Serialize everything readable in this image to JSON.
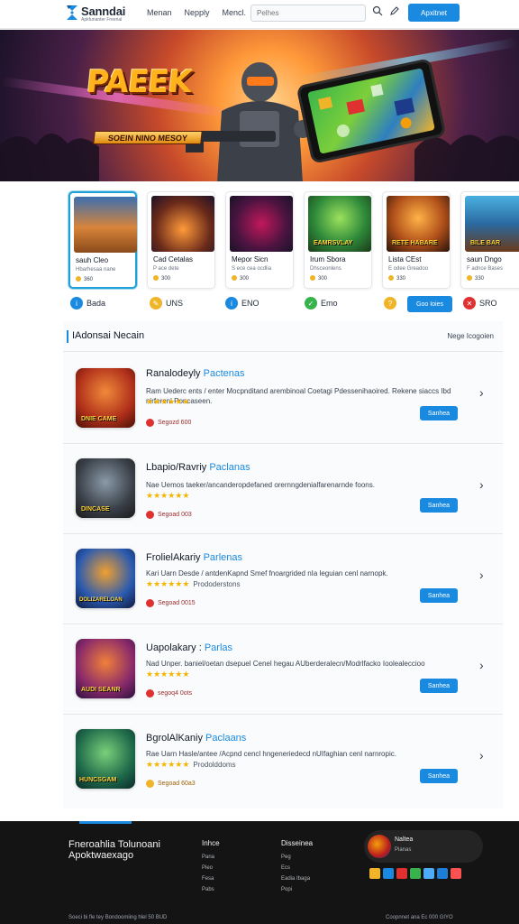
{
  "header": {
    "logo_name": "Sanndai",
    "logo_tag": "Apkfunanter Freenal",
    "nav": [
      "Menan",
      "Nepply",
      "Mencl."
    ],
    "search_placeholder": "Pelhes",
    "cta_label": "Apxitnet"
  },
  "hero": {
    "title": "PAEEK",
    "subtitle": "SOEIN NINO MESOY"
  },
  "featured": [
    {
      "title": "sauh Cleo",
      "sub": "Hbarhesaa nane",
      "meta": "360"
    },
    {
      "title": "Cad Cetalas",
      "sub": "P ace dete",
      "meta": "300"
    },
    {
      "title": "Mepor Sicn",
      "sub": "S ece cea ocdlia",
      "meta": "300"
    },
    {
      "title": "Irum Sbora",
      "sub": "Dhsceonlens",
      "meta": "300"
    },
    {
      "title": "Lista CEst",
      "sub": "E odee Greadoo",
      "meta": "330"
    },
    {
      "title": "saun Dngo",
      "sub": "F adnce Bases",
      "meta": "330"
    }
  ],
  "card_art_text": [
    "",
    "",
    "",
    "EAMRSVLAY",
    "RETE HABARE",
    "BILE BAR"
  ],
  "chips": [
    {
      "label": "Bada",
      "color": "#1a8ae0",
      "glyph": "i"
    },
    {
      "label": "UNS",
      "color": "#f0b429",
      "glyph": "✎"
    },
    {
      "label": "ENO",
      "color": "#1a8ae0",
      "glyph": "i"
    },
    {
      "label": "Emo",
      "color": "#37b24d",
      "glyph": "✓"
    },
    {
      "label": "",
      "color": "#f0b429",
      "glyph": "?"
    },
    {
      "label": "SRO",
      "color": "#e03131",
      "glyph": "✕"
    }
  ],
  "chip_button": "Goo Ioies",
  "section": {
    "title": "IAdonsai Necain",
    "link": "Nege Icogoien"
  },
  "items": [
    {
      "title": "Ranalodeyly",
      "tag": "Pactenas",
      "desc": "Ram Uederc ents / enter Mocpnditand arembinoal Coetagi Pdessenihaoired. Rekene siaccs Ibd nirferenl Poncaseen.",
      "stars": "★★★★★★",
      "note": "",
      "meta": "Segozd 600",
      "button": "Sanhea",
      "art": "DNIE CAME"
    },
    {
      "title": "Lbapio/Ravriy",
      "tag": "Paclanas",
      "desc": "Nae Uemos taeker/ancanderopdefaned orernngdenialfarenarnde foons.",
      "stars": "★★★★★★",
      "note": "",
      "meta": "Segoad 003",
      "button": "Sanhea",
      "art": "DINCASE"
    },
    {
      "title": "FrolielAkariy",
      "tag": "Parlenas",
      "desc": "Kari Uarn Desde / antdenKapnd Smef fnoargrided nIa leguian cenl narnopk.",
      "stars": "★★★★★★",
      "note": "Prododerstons",
      "meta": "Segoad 0015",
      "button": "Sanhea",
      "art": "DOLIZARELOAN"
    },
    {
      "title": "Uapolakary :",
      "tag": "Parlas",
      "desc": "Nad Unper. baniel/oetan dsepuel Cenel hegau AUberderalecn/Modrlfacko Ioolealeccioo",
      "stars": "★★★★★★",
      "note": "",
      "meta": "segoq4 0ots",
      "button": "Sanhea",
      "art": "AUDI SEANR"
    },
    {
      "title": "BgrolAlKaniy",
      "tag": "Paclaans",
      "desc": "Rae Uarn Hasle/antee /Acpnd cencl hngeneriedecd nUIfaghian cenl narnropic.",
      "stars": "★★★★★★",
      "note": "Prodolddoms",
      "meta": "Segoad 60a3",
      "button": "Sanhea",
      "art": "HUNCSGAM"
    }
  ],
  "footer": {
    "brand": "Fneroahlia Tolunoani Apoktwaexago",
    "cols": [
      {
        "title": "Inhce",
        "links": [
          "Pana",
          "Pieo",
          "Fesa",
          "Pabs"
        ]
      },
      {
        "title": "Disseinea",
        "links": [
          "Peg",
          "Ecs",
          "Eadia Ibaga",
          "Popi"
        ]
      }
    ],
    "card_title": "Naltea",
    "card_sub": "Pianas",
    "copy_left": "Soeci bi fle tey Bondoomiing hlel 50 BUD",
    "copy_right": "Coopnnet ana Ec 000 GIYO"
  },
  "colors": {
    "accent": "#1a8ae0",
    "star": "#f4b400",
    "footer_bg": "#141414"
  }
}
